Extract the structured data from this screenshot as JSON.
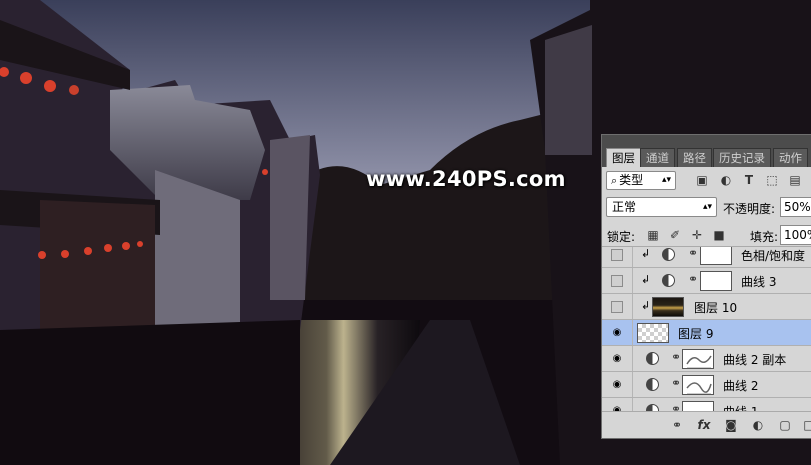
{
  "watermark": "www.240PS.com",
  "panel": {
    "tabs": [
      {
        "label": "图层",
        "active": true
      },
      {
        "label": "通道",
        "active": false
      },
      {
        "label": "路径",
        "active": false
      },
      {
        "label": "历史记录",
        "active": false
      },
      {
        "label": "动作",
        "active": false
      }
    ],
    "kind_filter": "类型",
    "blend_mode": "正常",
    "opacity_label": "不透明度:",
    "opacity_value": "50%",
    "lock_label": "锁定:",
    "fill_label": "填充:",
    "fill_value": "100%",
    "layers": [
      {
        "name": "色相/饱和度",
        "visible": false,
        "clipped": true,
        "type": "adjustment",
        "selected": false
      },
      {
        "name": "曲线 3",
        "visible": false,
        "clipped": true,
        "type": "adjustment",
        "selected": false
      },
      {
        "name": "图层 10",
        "visible": false,
        "clipped": true,
        "type": "image",
        "selected": false
      },
      {
        "name": "图层 9",
        "visible": true,
        "clipped": false,
        "type": "transparent",
        "selected": true
      },
      {
        "name": "曲线 2 副本",
        "visible": true,
        "clipped": false,
        "type": "curve",
        "selected": false
      },
      {
        "name": "曲线 2",
        "visible": true,
        "clipped": false,
        "type": "curve",
        "selected": false
      },
      {
        "name": "曲线 1",
        "visible": true,
        "clipped": false,
        "type": "adjustment",
        "selected": false
      }
    ],
    "icons": {
      "filter": [
        "image-filter-icon",
        "adjustment-filter-icon",
        "type-filter-icon",
        "shape-filter-icon",
        "smart-object-filter-icon"
      ],
      "lock": [
        "lock-pixels-icon",
        "lock-paint-icon",
        "lock-move-icon",
        "lock-all-icon"
      ],
      "footer": [
        "link-icon",
        "fx-icon",
        "mask-icon",
        "adjustment-icon",
        "folder-icon",
        "new-layer-icon"
      ]
    }
  },
  "colors": {
    "selected_layer": "#a8c2ef",
    "panel_bg": "#d6d6d6",
    "tabbar_bg": "#4c4c4c"
  }
}
